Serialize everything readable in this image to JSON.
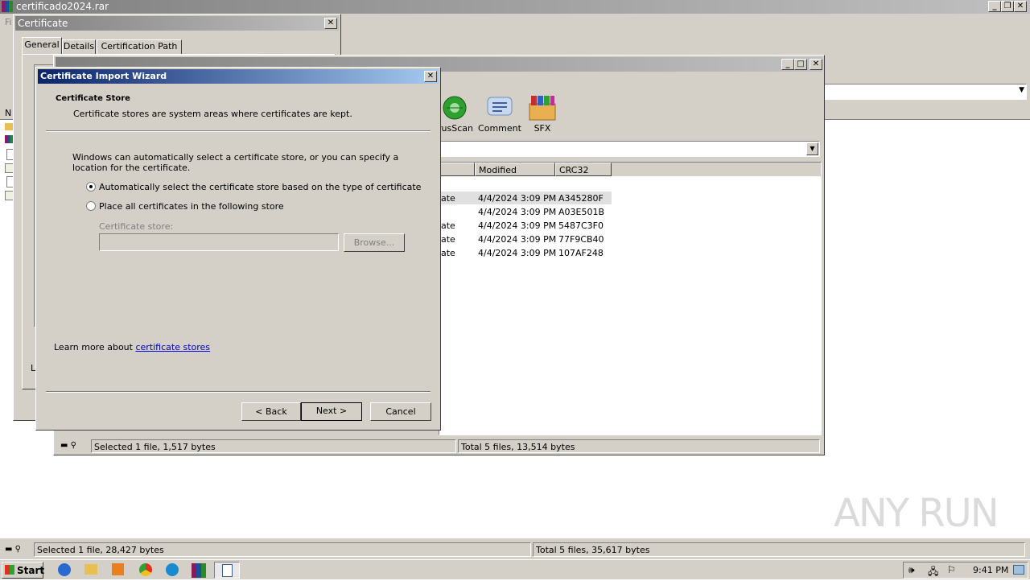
{
  "main_window": {
    "title": "certificado2024.rar",
    "menu_first": "Fi",
    "list_first_header": "N",
    "status_left": "Selected 1 file, 28,427 bytes",
    "status_right": "Total 5 files, 35,617 bytes"
  },
  "certificate_dialog": {
    "title": "Certificate",
    "tabs": [
      "General",
      "Details",
      "Certification Path"
    ],
    "partial_text": "Le"
  },
  "archive_window": {
    "toolbar": [
      "rusScan",
      "Comment",
      "SFX"
    ],
    "columns": [
      "Modified",
      "CRC32"
    ],
    "rows": [
      {
        "type": "ate",
        "modified": "4/4/2024 3:09 PM",
        "crc": "A345280F"
      },
      {
        "type": "",
        "modified": "4/4/2024 3:09 PM",
        "crc": "A03E501B"
      },
      {
        "type": "ate",
        "modified": "4/4/2024 3:09 PM",
        "crc": "5487C3F0"
      },
      {
        "type": "ate",
        "modified": "4/4/2024 3:09 PM",
        "crc": "77F9CB40"
      },
      {
        "type": "ate",
        "modified": "4/4/2024 3:09 PM",
        "crc": "107AF248"
      }
    ],
    "status_left": "Selected 1 file, 1,517 bytes",
    "status_right": "Total 5 files, 13,514 bytes"
  },
  "wizard": {
    "title": "Certificate Import Wizard",
    "heading": "Certificate Store",
    "subheading": "Certificate stores are system areas where certificates are kept.",
    "description": "Windows can automatically select a certificate store, or you can specify a location for the certificate.",
    "option_auto": "Automatically select the certificate store based on the type of certificate",
    "option_manual": "Place all certificates in the following store",
    "store_label": "Certificate store:",
    "store_value": "",
    "browse": "Browse...",
    "learn_prefix": "Learn more about ",
    "learn_link": "certificate stores",
    "back": "< Back",
    "next": "Next >",
    "cancel": "Cancel"
  },
  "taskbar": {
    "start": "Start",
    "clock": "9:41 PM"
  },
  "watermark": "ANY RUN",
  "colors": {
    "title_active_start": "#0a246a",
    "title_active_end": "#a6caf0",
    "title_inactive": "#808080",
    "face": "#d4d0c8",
    "link": "#0000cc"
  }
}
